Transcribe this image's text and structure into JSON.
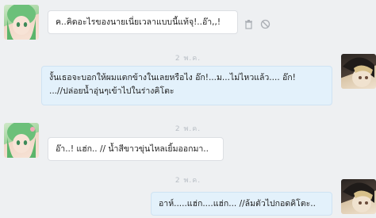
{
  "messages": [
    {
      "side": "in",
      "text": "ค..คิดอะไรของนายเนี่ยเวลาแบบนี้แท้จุ!..อ๊า,,!"
    },
    {
      "side": "out",
      "timestamp": "2 พ.ค.",
      "text_line1": "งั้นเธอจะบอกให้ผมแตกข้างในเลยหรือไง อ๊ก!...ม...ไม่ไหวแล้ว.... อ๊ก!",
      "text_line2": "...//ปล่อยน้ำอุ่นๆเข้าไปในร่างคิโตะ"
    },
    {
      "side": "in",
      "timestamp": "2 พ.ค.",
      "text": "อ๊า..! แฮ่ก.. // น้ำสีขาวขุ่นไหลเยิ้มออกมา.."
    },
    {
      "side": "out",
      "timestamp": "2 พ.ค.",
      "text": "อาห์.....แฮ่ก....แฮ่ก... //ล้มตัวไปกอดคิโตะ.."
    }
  ],
  "icons": {
    "delete": "trash-icon",
    "block": "block-icon"
  }
}
